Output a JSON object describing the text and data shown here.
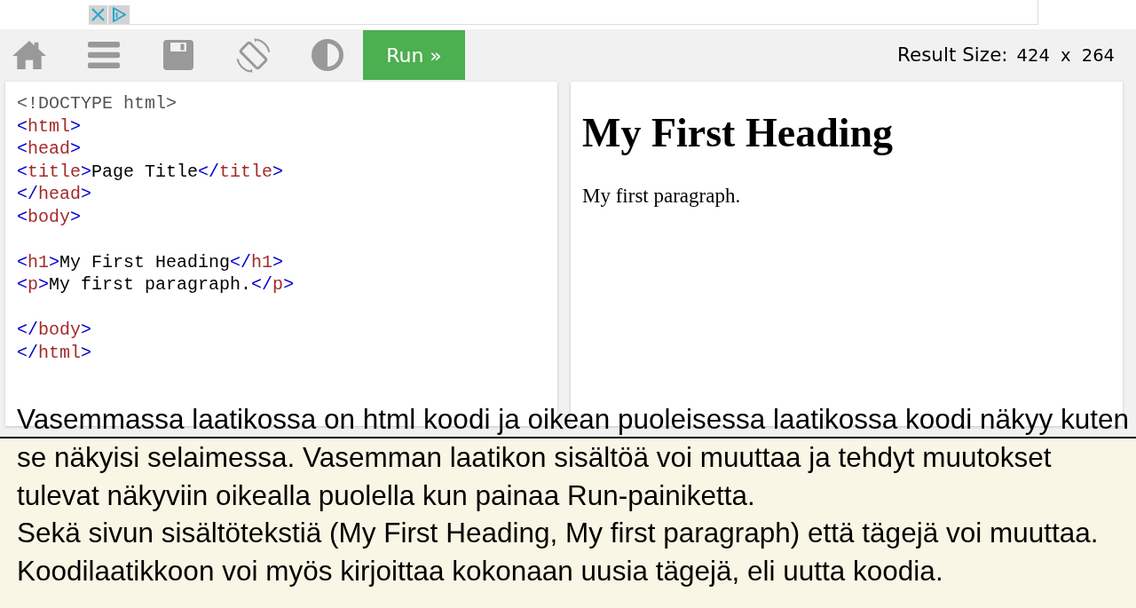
{
  "toolbar": {
    "run_button": {
      "label": "Run »"
    },
    "result_size": {
      "label": "Result Size:",
      "value": "424 x 264"
    }
  },
  "editor": {
    "lines": [
      {
        "kind": "code",
        "tokens": [
          {
            "kind": "doctype",
            "text": "<!DOCTYPE html>"
          }
        ]
      },
      {
        "kind": "code",
        "tokens": [
          {
            "kind": "bracket",
            "text": "<"
          },
          {
            "kind": "tag",
            "text": "html"
          },
          {
            "kind": "bracket",
            "text": ">"
          }
        ]
      },
      {
        "kind": "code",
        "tokens": [
          {
            "kind": "bracket",
            "text": "<"
          },
          {
            "kind": "tag",
            "text": "head"
          },
          {
            "kind": "bracket",
            "text": ">"
          }
        ]
      },
      {
        "kind": "code",
        "tokens": [
          {
            "kind": "bracket",
            "text": "<"
          },
          {
            "kind": "tag",
            "text": "title"
          },
          {
            "kind": "bracket",
            "text": ">"
          },
          {
            "kind": "text",
            "text": "Page Title"
          },
          {
            "kind": "bracket",
            "text": "</"
          },
          {
            "kind": "tag",
            "text": "title"
          },
          {
            "kind": "bracket",
            "text": ">"
          }
        ]
      },
      {
        "kind": "code",
        "tokens": [
          {
            "kind": "bracket",
            "text": "</"
          },
          {
            "kind": "tag",
            "text": "head"
          },
          {
            "kind": "bracket",
            "text": ">"
          }
        ]
      },
      {
        "kind": "code",
        "tokens": [
          {
            "kind": "bracket",
            "text": "<"
          },
          {
            "kind": "tag",
            "text": "body"
          },
          {
            "kind": "bracket",
            "text": ">"
          }
        ]
      },
      {
        "kind": "blank"
      },
      {
        "kind": "code",
        "tokens": [
          {
            "kind": "bracket",
            "text": "<"
          },
          {
            "kind": "tag",
            "text": "h1"
          },
          {
            "kind": "bracket",
            "text": ">"
          },
          {
            "kind": "text",
            "text": "My First Heading"
          },
          {
            "kind": "bracket",
            "text": "</"
          },
          {
            "kind": "tag",
            "text": "h1"
          },
          {
            "kind": "bracket",
            "text": ">"
          }
        ]
      },
      {
        "kind": "code",
        "tokens": [
          {
            "kind": "bracket",
            "text": "<"
          },
          {
            "kind": "tag",
            "text": "p"
          },
          {
            "kind": "bracket",
            "text": ">"
          },
          {
            "kind": "text",
            "text": "My first paragraph."
          },
          {
            "kind": "bracket",
            "text": "</"
          },
          {
            "kind": "tag",
            "text": "p"
          },
          {
            "kind": "bracket",
            "text": ">"
          }
        ]
      },
      {
        "kind": "blank"
      },
      {
        "kind": "code",
        "tokens": [
          {
            "kind": "bracket",
            "text": "</"
          },
          {
            "kind": "tag",
            "text": "body"
          },
          {
            "kind": "bracket",
            "text": ">"
          }
        ]
      },
      {
        "kind": "code",
        "tokens": [
          {
            "kind": "bracket",
            "text": "</"
          },
          {
            "kind": "tag",
            "text": "html"
          },
          {
            "kind": "bracket",
            "text": ">"
          }
        ]
      }
    ]
  },
  "result": {
    "heading": "My First Heading",
    "paragraph": "My first paragraph."
  },
  "caption": {
    "paragraphs": [
      "Vasemmassa laatikossa on html koodi ja oikean puoleisessa laatikossa koodi näkyy kuten se näkyisi selaimessa. Vasemman laatikon sisältöä voi muuttaa ja tehdyt muutokset tulevat näkyviin oikealla puolella kun painaa Run-painiketta.",
      "Sekä sivun sisältötekstiä (My First Heading, My first paragraph) että tägejä voi muuttaa. Koodilaatikkoon voi myös kirjoittaa kokonaan uusia tägejä, eli uutta koodia."
    ]
  }
}
